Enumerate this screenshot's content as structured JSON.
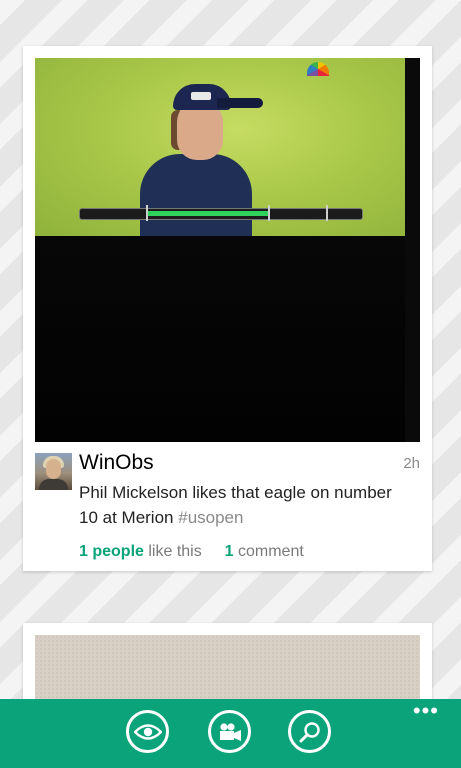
{
  "post": {
    "username": "WinObs",
    "time": "2h",
    "text": "Phil Mickelson likes that eagle on number 10 at Merion",
    "hashtag": "#usopen",
    "likes_count": "1 people",
    "likes_suffix": "like this",
    "comments_count": "1",
    "comments_suffix": "comment"
  },
  "appbar": {
    "buttons": [
      "eye-icon",
      "video-camera-icon",
      "search-icon"
    ],
    "more": "•••"
  },
  "colors": {
    "accent": "#0aa37a",
    "background": "#e6e6e6"
  }
}
